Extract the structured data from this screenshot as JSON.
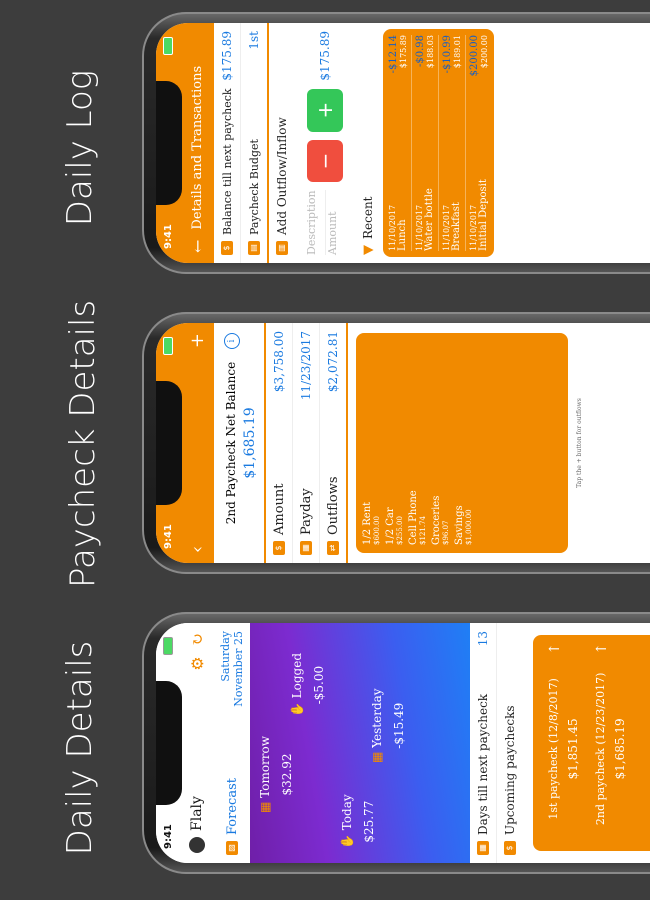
{
  "captions": [
    "Daily Log",
    "Paycheck Details",
    "Daily Details"
  ],
  "colors": {
    "accent": "#f18a00",
    "link": "#1a7ae0",
    "add_button": "#34c759",
    "remove_button": "#f04e3e",
    "background": "#3d3d3d"
  },
  "status_time": "9:41",
  "log": {
    "title": "Details and Transactions",
    "balance_label": "Balance till next paycheck",
    "balance_value": "$175.89",
    "budget_label": "Paycheck Budget",
    "budget_value": "1st",
    "add_label": "Add Outflow/Inflow",
    "description_placeholder": "Description",
    "amount_placeholder": "Amount",
    "add_button": "+",
    "remove_button": "−",
    "amount_display": "$175.89",
    "recent_label": "Recent",
    "transactions": [
      {
        "date": "11/10/2017",
        "name": "Lunch",
        "amount": "-$12.14",
        "balance": "$175.89"
      },
      {
        "date": "11/10/2017",
        "name": "Water bottle",
        "amount": "-$0.98",
        "balance": "$188.03"
      },
      {
        "date": "11/10/2017",
        "name": "Breakfast",
        "amount": "-$10.99",
        "balance": "$189.01"
      },
      {
        "date": "11/10/2017",
        "name": "Initial Deposit",
        "amount": "$200.00",
        "balance": "$200.00"
      }
    ]
  },
  "paycheck": {
    "back_icon": "chevron-left-icon",
    "plus": "+",
    "net_balance_label": "2nd Paycheck Net Balance",
    "net_balance_value": "$1,685.19",
    "info": "i",
    "amount_label": "Amount",
    "amount_value": "$3,758.00",
    "payday_label": "Payday",
    "payday_value": "11/23/2017",
    "outflows_label": "Outflows",
    "outflows_value": "$2,072.81",
    "outflows": [
      {
        "name": "1/2 Rent",
        "value": "$600.00"
      },
      {
        "name": "1/2 Car",
        "value": "$255.00"
      },
      {
        "name": "Cell Phone",
        "value": "$121.74"
      },
      {
        "name": "Groceries",
        "value": "$96.07"
      },
      {
        "name": "Savings",
        "value": "$1,000.00"
      }
    ],
    "hint": "Tap the + button for outflows"
  },
  "daily": {
    "app_name": "Flaly",
    "forecast_label": "Forecast",
    "date_line1": "Saturday",
    "date_line2": "November 25",
    "tomorrow_label": "Tomorrow",
    "tomorrow_value": "$32.92",
    "logged_label": "Logged",
    "logged_value": "-$5.00",
    "today_label": "Today",
    "today_value": "$25.77",
    "yesterday_label": "Yesterday",
    "yesterday_value": "-$15.49",
    "days_label": "Days till next paycheck",
    "days_value": "13",
    "upcoming_label": "Upcoming paychecks",
    "paychecks": [
      {
        "label": "1st paycheck (12/8/2017)",
        "value": "$1,851.45"
      },
      {
        "label": "2nd paycheck (12/23/2017)",
        "value": "$1,685.19"
      }
    ]
  }
}
